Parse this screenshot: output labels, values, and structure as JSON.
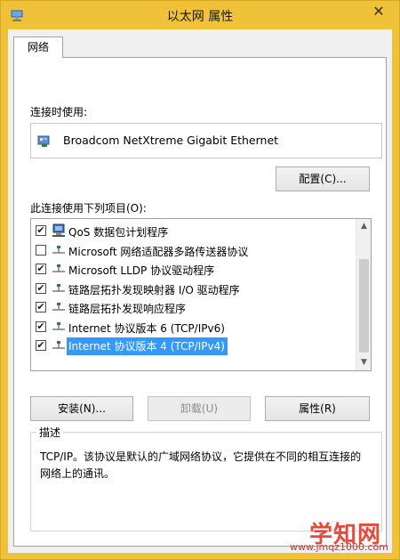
{
  "window": {
    "title": "以太网 属性",
    "close_glyph": "✕"
  },
  "tabs": [
    {
      "label": "网络"
    }
  ],
  "connect_using": {
    "label": "连接时使用:",
    "adapter_name": "Broadcom NetXtreme Gigabit Ethernet",
    "configure_button": "配置(C)..."
  },
  "items_section": {
    "label": "此连接使用下列项目(O):",
    "items": [
      {
        "label": "QoS 数据包计划程序",
        "checked": true,
        "icon": "qos-icon",
        "selected": false
      },
      {
        "label": "Microsoft 网络适配器多路传送器协议",
        "checked": false,
        "icon": "protocol-icon",
        "selected": false
      },
      {
        "label": "Microsoft LLDP 协议驱动程序",
        "checked": true,
        "icon": "protocol-icon",
        "selected": false
      },
      {
        "label": "链路层拓扑发现映射器 I/O 驱动程序",
        "checked": true,
        "icon": "protocol-icon",
        "selected": false
      },
      {
        "label": "链路层拓扑发现响应程序",
        "checked": true,
        "icon": "protocol-icon",
        "selected": false
      },
      {
        "label": "Internet 协议版本 6 (TCP/IPv6)",
        "checked": true,
        "icon": "protocol-icon",
        "selected": false
      },
      {
        "label": "Internet 协议版本 4 (TCP/IPv4)",
        "checked": true,
        "icon": "protocol-icon",
        "selected": true
      }
    ]
  },
  "buttons": {
    "install": "安装(N)...",
    "uninstall": "卸载(U)",
    "properties": "属性(R)"
  },
  "description": {
    "legend": "描述",
    "text": "TCP/IP。该协议是默认的广域网络协议，它提供在不同的相互连接的网络上的通讯。"
  },
  "watermark": {
    "title": "学知网",
    "url": "www.jmqz1000.com"
  },
  "colors": {
    "title_bar": "#f0c23a",
    "selection": "#3399ff"
  }
}
